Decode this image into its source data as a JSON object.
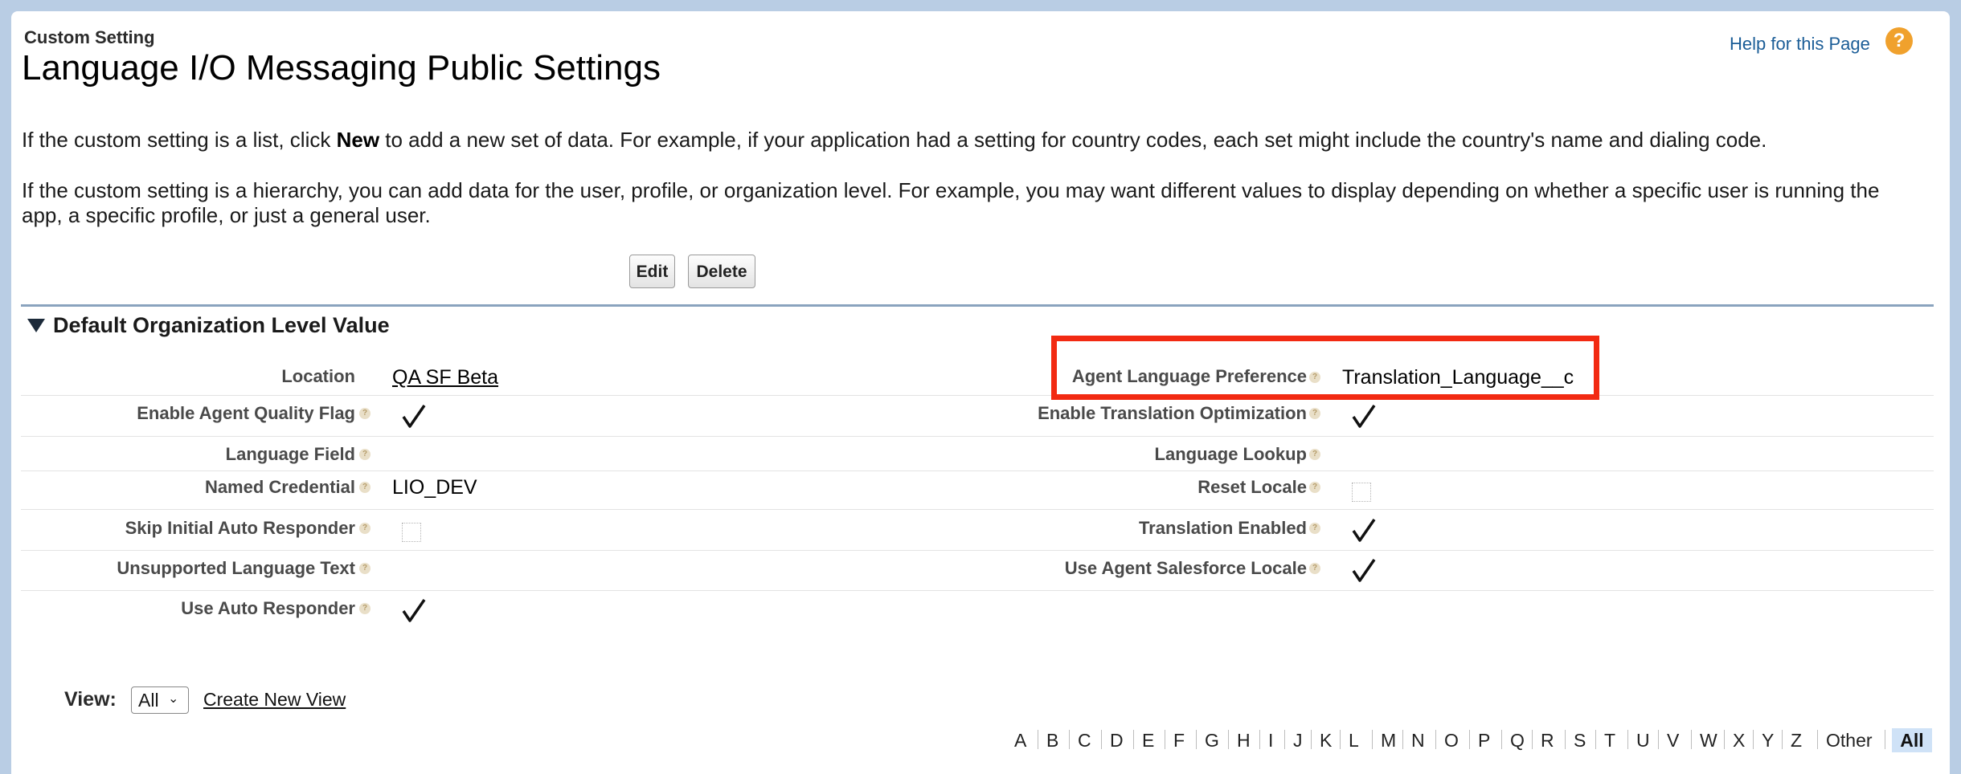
{
  "header": {
    "subtitle": "Custom Setting",
    "title": "Language I/O Messaging Public Settings",
    "help_link": "Help for this Page",
    "help_icon": "?"
  },
  "intro": {
    "para1_before": "If the custom setting is a list, click ",
    "para1_bold": "New",
    "para1_after": " to add a new set of data. For example, if your application had a setting for country codes, each set might include the country's name and dialing code.",
    "para2": "If the custom setting is a hierarchy, you can add data for the user, profile, or organization level. For example, you may want different values to display depending on whether a specific user is running the app, a specific profile, or just a general user."
  },
  "buttons": {
    "edit": "Edit",
    "delete": "Delete"
  },
  "section": {
    "title": "Default Organization Level Value"
  },
  "fields": {
    "location": {
      "label": "Location",
      "value": "QA SF Beta"
    },
    "agent_language_preference": {
      "label": "Agent Language Preference",
      "value": "Translation_Language__c"
    },
    "enable_agent_quality_flag": {
      "label": "Enable Agent Quality Flag",
      "checked": true
    },
    "enable_translation_optimization": {
      "label": "Enable Translation Optimization",
      "checked": true
    },
    "language_field": {
      "label": "Language Field",
      "value": ""
    },
    "language_lookup": {
      "label": "Language Lookup",
      "value": ""
    },
    "named_credential": {
      "label": "Named Credential",
      "value": "LIO_DEV"
    },
    "reset_locale": {
      "label": "Reset Locale",
      "checked": false
    },
    "skip_initial_auto_responder": {
      "label": "Skip Initial Auto Responder",
      "checked": false
    },
    "translation_enabled": {
      "label": "Translation Enabled",
      "checked": true
    },
    "unsupported_language_text": {
      "label": "Unsupported Language Text",
      "value": ""
    },
    "use_agent_salesforce_locale": {
      "label": "Use Agent Salesforce Locale",
      "checked": true
    },
    "use_auto_responder": {
      "label": "Use Auto Responder",
      "checked": true
    }
  },
  "help_glyph": "?",
  "list_view": {
    "label": "View:",
    "selected": "All",
    "create_new_view": "Create New View"
  },
  "alphabet": [
    "A",
    "B",
    "C",
    "D",
    "E",
    "F",
    "G",
    "H",
    "I",
    "J",
    "K",
    "L",
    "M",
    "N",
    "O",
    "P",
    "Q",
    "R",
    "S",
    "T",
    "U",
    "V",
    "W",
    "X",
    "Y",
    "Z",
    "Other"
  ],
  "alphabet_all": "All",
  "colors": {
    "highlight_border": "#f22a12",
    "link": "#1b5d97",
    "help_icon": "#f0a12d",
    "section_rule": "#8aa3be",
    "all_selected_bg": "#cfe2f7"
  }
}
